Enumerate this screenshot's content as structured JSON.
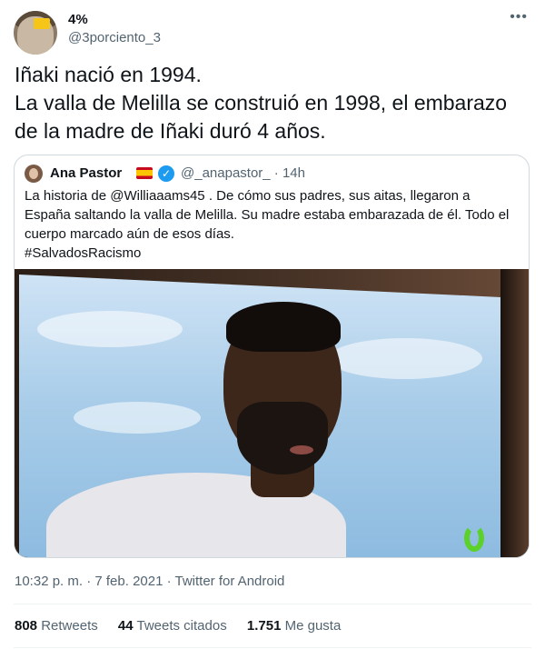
{
  "author": {
    "name": "4%",
    "handle": "@3porciento_3",
    "more_icon": "more-horizontal-icon"
  },
  "tweet": {
    "lines": [
      "Iñaki nació en 1994.",
      "La valla de Melilla se construió en 1998, el embarazo",
      "de la madre de Iñaki duró 4 años."
    ]
  },
  "quote": {
    "name": "Ana Pastor",
    "handle_time": "@_anapastor_ · 14h",
    "lines": [
      "La historia de @Williaaams45 . De cómo sus padres, sus aitas, llegaron a",
      "España saltando la valla de Melilla. Su madre estaba embarazada de él. Todo el",
      "cuerpo marcado aún de esos días.",
      " #SalvadosRacismo"
    ]
  },
  "meta": {
    "timestamp": "10:32 p. m. · 7 feb. 2021 · Twitter for Android"
  },
  "stats": {
    "retweets_count": "808",
    "retweets_label": "Retweets",
    "quotes_count": "44",
    "quotes_label": "Tweets citados",
    "likes_count": "1.751",
    "likes_label": "Me gusta"
  },
  "colors": {
    "text": "#0f1419",
    "secondary": "#536471",
    "border": "#cfd9de",
    "verified": "#1d9bf0"
  }
}
